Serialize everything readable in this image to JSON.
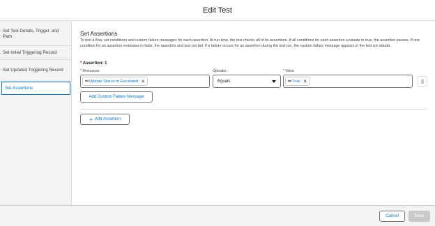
{
  "header": {
    "title": "Edit Test"
  },
  "sidebar": {
    "steps": [
      {
        "label": "Set Test Details, Trigger, and Path"
      },
      {
        "label": "Set Initial Triggering Record"
      },
      {
        "label": "Set Updated Triggering Record"
      },
      {
        "label": "Set Assertions",
        "active": true
      }
    ]
  },
  "main": {
    "heading": "Set Assertions",
    "description": "To test a flow, set conditions and custom failure messages for each assertion. At run time, the test checks all of its assertions. If all conditions for each assertion evaluate to true, the assertion passes. If one condition for an assertion evaluates to false, the assertion and test run fail. If a failure occurs for an assertion during the test run, the custom failure message appears in the test run details.",
    "assertion_title": "Assertion: 1",
    "required_mark": "*",
    "fields": {
      "resource_label": "Resources",
      "operator_label": "Operator",
      "value_label": "Value",
      "resource_value": "Update Status to Escalated",
      "operator_value": "Equals",
      "value_value": "True"
    },
    "icons": {
      "resource": "infinity-icon",
      "value": "infinity-icon",
      "delete": "trash-icon",
      "add": "plus-icon"
    },
    "add_failure_message": "Add Custom Failure Message",
    "add_assertion": "Add Assertion"
  },
  "footer": {
    "cancel": "Cancel",
    "save": "Save"
  },
  "colors": {
    "brand": "#0176d3",
    "required": "#ba0517",
    "disabled": "#c9c9c9"
  }
}
